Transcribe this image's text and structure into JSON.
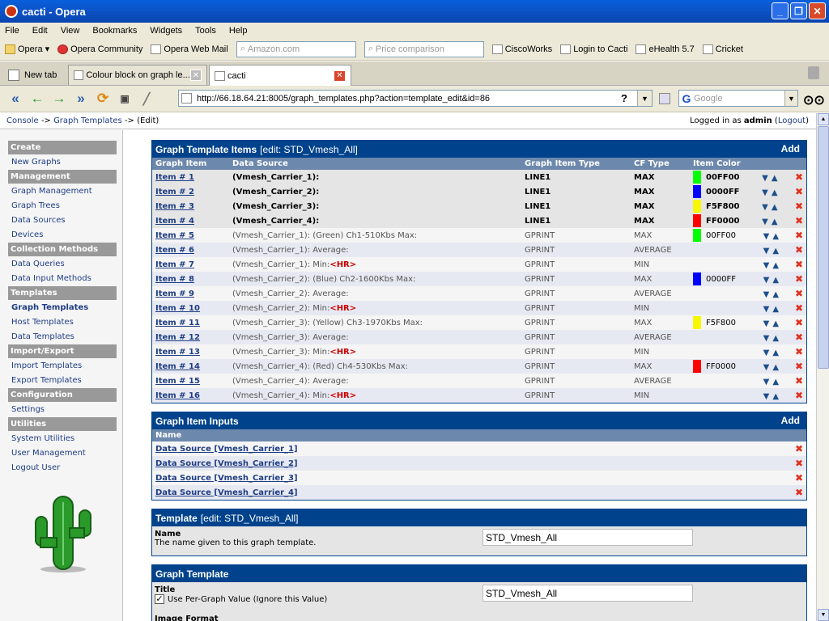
{
  "window": {
    "title": "cacti - Opera"
  },
  "menu": [
    "File",
    "Edit",
    "View",
    "Bookmarks",
    "Widgets",
    "Tools",
    "Help"
  ],
  "personal_bar": {
    "items": [
      "Opera",
      "Opera Community",
      "Opera Web Mail"
    ],
    "search1_placeholder": "Amazon.com",
    "search2_placeholder": "Price comparison",
    "items2": [
      "CiscoWorks",
      "Login to Cacti",
      "eHealth 5.7",
      "Cricket"
    ]
  },
  "tabs": {
    "new_tab": "New tab",
    "tab1": "Colour block on graph le...",
    "tab2": "cacti"
  },
  "address": {
    "url": "http://66.18.64.21:8005/graph_templates.php?action=template_edit&id=86",
    "search_placeholder": "Google"
  },
  "breadcrumb": {
    "console": "Console",
    "graph_templates": "Graph Templates",
    "edit": "(Edit)"
  },
  "login": {
    "prefix": "Logged in as",
    "user": "admin",
    "logout": "Logout"
  },
  "sidebar": {
    "create": "Create",
    "new_graphs": "New Graphs",
    "management": "Management",
    "graph_management": "Graph Management",
    "graph_trees": "Graph Trees",
    "data_sources": "Data Sources",
    "devices": "Devices",
    "collection_methods": "Collection Methods",
    "data_queries": "Data Queries",
    "data_input_methods": "Data Input Methods",
    "templates": "Templates",
    "graph_templates": "Graph Templates",
    "host_templates": "Host Templates",
    "data_templates": "Data Templates",
    "import_export": "Import/Export",
    "import_templates": "Import Templates",
    "export_templates": "Export Templates",
    "configuration": "Configuration",
    "settings": "Settings",
    "utilities": "Utilities",
    "system_utilities": "System Utilities",
    "user_management": "User Management",
    "logout_user": "Logout User"
  },
  "items_panel": {
    "title": "Graph Template Items",
    "subtitle": "[edit: STD_Vmesh_All]",
    "add": "Add",
    "columns": {
      "item": "Graph Item",
      "source": "Data Source",
      "type": "Graph Item Type",
      "cf": "CF Type",
      "color": "Item Color"
    },
    "rows": [
      {
        "item": "Item # 1",
        "source": "(Vmesh_Carrier_1):",
        "hr": "",
        "type": "LINE1",
        "cf": "MAX",
        "color": "00FF00",
        "swatch": "#00ff00",
        "bold": true
      },
      {
        "item": "Item # 2",
        "source": "(Vmesh_Carrier_2):",
        "hr": "",
        "type": "LINE1",
        "cf": "MAX",
        "color": "0000FF",
        "swatch": "#0000ff",
        "bold": true
      },
      {
        "item": "Item # 3",
        "source": "(Vmesh_Carrier_3):",
        "hr": "",
        "type": "LINE1",
        "cf": "MAX",
        "color": "F5F800",
        "swatch": "#f5f800",
        "bold": true
      },
      {
        "item": "Item # 4",
        "source": "(Vmesh_Carrier_4):",
        "hr": "",
        "type": "LINE1",
        "cf": "MAX",
        "color": "FF0000",
        "swatch": "#ff0000",
        "bold": true
      },
      {
        "item": "Item # 5",
        "source": "(Vmesh_Carrier_1): (Green) Ch1-510Kbs Max:",
        "hr": "",
        "type": "GPRINT",
        "cf": "MAX",
        "color": "00FF00",
        "swatch": "#00ff00",
        "bold": false
      },
      {
        "item": "Item # 6",
        "source": "(Vmesh_Carrier_1): Average:",
        "hr": "",
        "type": "GPRINT",
        "cf": "AVERAGE",
        "color": "",
        "swatch": "",
        "bold": false
      },
      {
        "item": "Item # 7",
        "source": "(Vmesh_Carrier_1): Min:",
        "hr": "<HR>",
        "type": "GPRINT",
        "cf": "MIN",
        "color": "",
        "swatch": "",
        "bold": false
      },
      {
        "item": "Item # 8",
        "source": "(Vmesh_Carrier_2): (Blue) Ch2-1600Kbs Max:",
        "hr": "",
        "type": "GPRINT",
        "cf": "MAX",
        "color": "0000FF",
        "swatch": "#0000ff",
        "bold": false
      },
      {
        "item": "Item # 9",
        "source": "(Vmesh_Carrier_2): Average:",
        "hr": "",
        "type": "GPRINT",
        "cf": "AVERAGE",
        "color": "",
        "swatch": "",
        "bold": false
      },
      {
        "item": "Item # 10",
        "source": "(Vmesh_Carrier_2): Min:",
        "hr": "<HR>",
        "type": "GPRINT",
        "cf": "MIN",
        "color": "",
        "swatch": "",
        "bold": false
      },
      {
        "item": "Item # 11",
        "source": "(Vmesh_Carrier_3): (Yellow) Ch3-1970Kbs Max:",
        "hr": "",
        "type": "GPRINT",
        "cf": "MAX",
        "color": "F5F800",
        "swatch": "#f5f800",
        "bold": false
      },
      {
        "item": "Item # 12",
        "source": "(Vmesh_Carrier_3): Average:",
        "hr": "",
        "type": "GPRINT",
        "cf": "AVERAGE",
        "color": "",
        "swatch": "",
        "bold": false
      },
      {
        "item": "Item # 13",
        "source": "(Vmesh_Carrier_3): Min:",
        "hr": "<HR>",
        "type": "GPRINT",
        "cf": "MIN",
        "color": "",
        "swatch": "",
        "bold": false
      },
      {
        "item": "Item # 14",
        "source": "(Vmesh_Carrier_4): (Red) Ch4-530Kbs Max:",
        "hr": "",
        "type": "GPRINT",
        "cf": "MAX",
        "color": "FF0000",
        "swatch": "#ff0000",
        "bold": false
      },
      {
        "item": "Item # 15",
        "source": "(Vmesh_Carrier_4): Average:",
        "hr": "",
        "type": "GPRINT",
        "cf": "AVERAGE",
        "color": "",
        "swatch": "",
        "bold": false
      },
      {
        "item": "Item # 16",
        "source": "(Vmesh_Carrier_4): Min:",
        "hr": "<HR>",
        "type": "GPRINT",
        "cf": "MIN",
        "color": "",
        "swatch": "",
        "bold": false
      }
    ]
  },
  "inputs_panel": {
    "title": "Graph Item Inputs",
    "add": "Add",
    "column": "Name",
    "rows": [
      "Data Source [Vmesh_Carrier_1]",
      "Data Source [Vmesh_Carrier_2]",
      "Data Source [Vmesh_Carrier_3]",
      "Data Source [Vmesh_Carrier_4]"
    ]
  },
  "template_panel": {
    "title": "Template",
    "subtitle": "[edit: STD_Vmesh_All]",
    "name_label": "Name",
    "name_desc": "The name given to this graph template.",
    "name_value": "STD_Vmesh_All"
  },
  "graph_template_panel": {
    "title": "Graph Template",
    "title_label": "Title",
    "per_graph": "Use Per-Graph Value (Ignore this Value)",
    "title_value": "STD_Vmesh_All",
    "image_format": "Image Format"
  }
}
